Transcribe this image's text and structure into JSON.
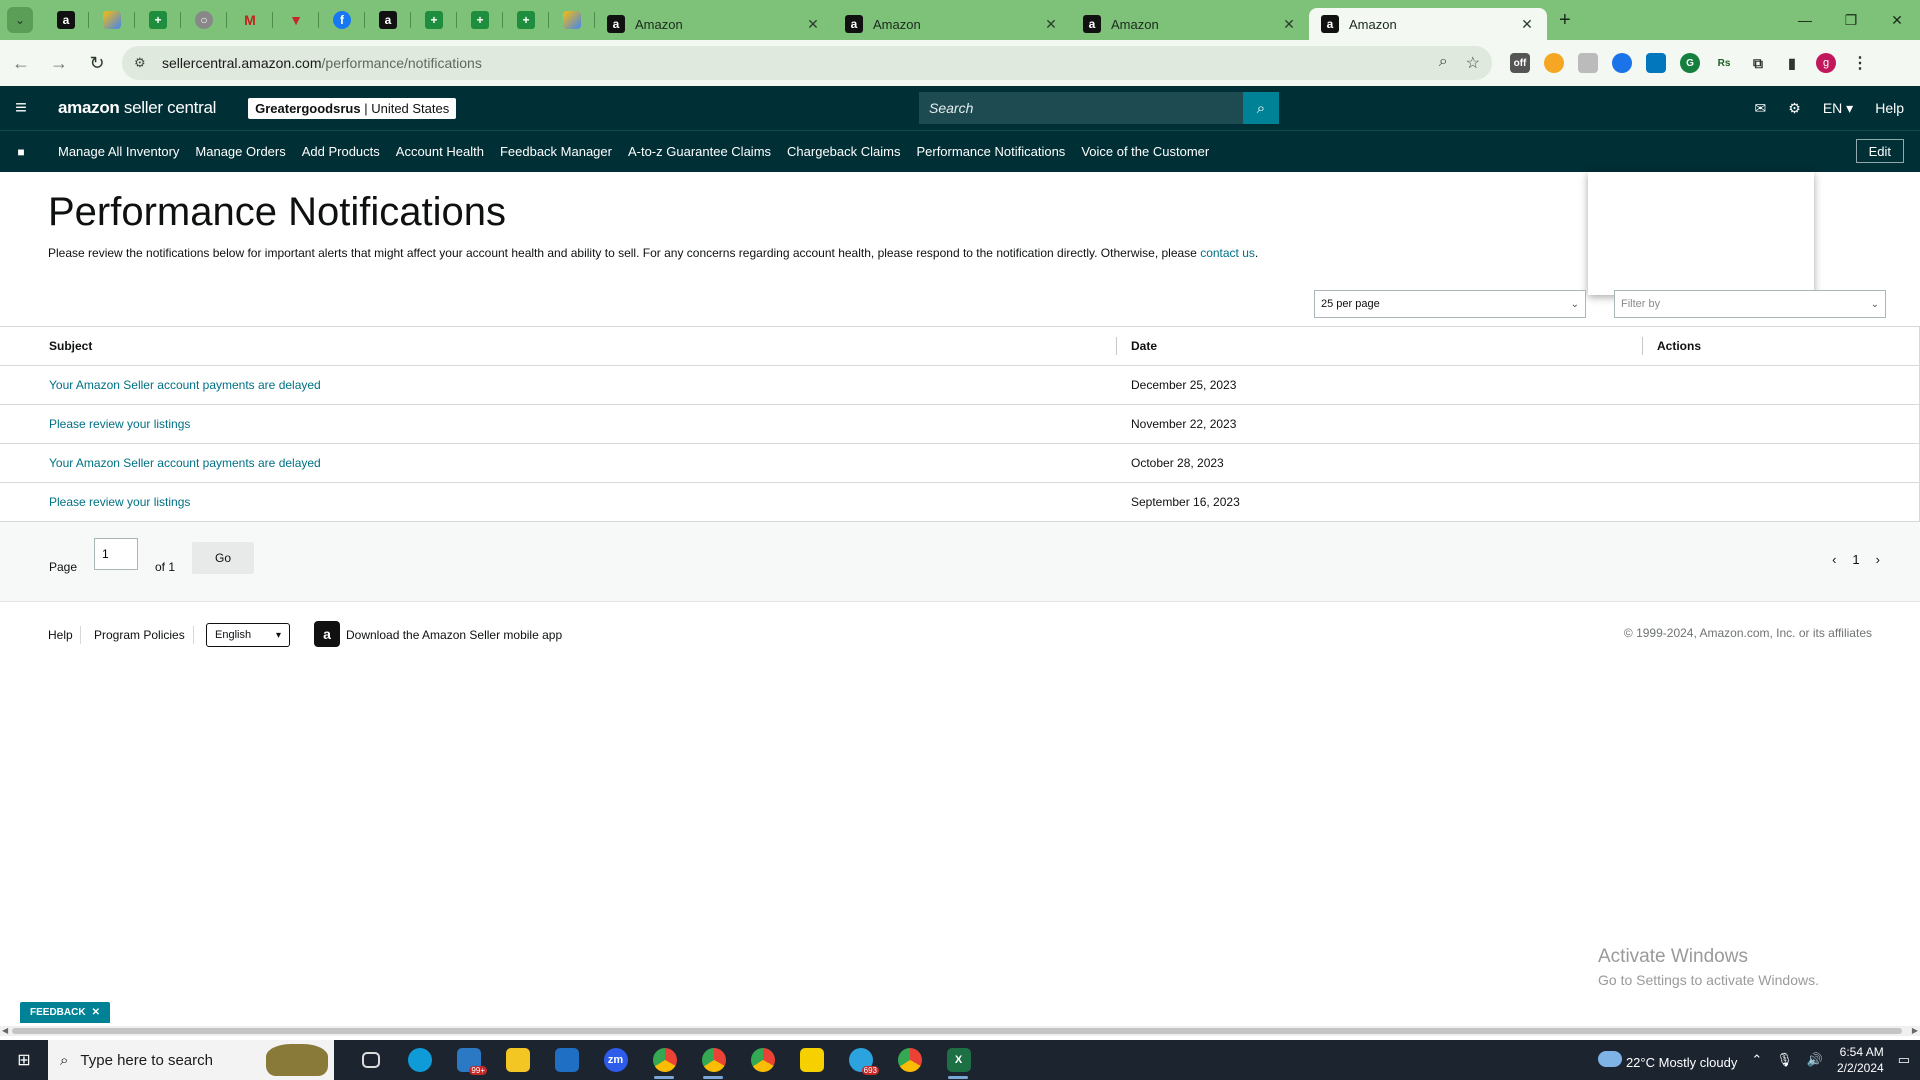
{
  "browser": {
    "tabs": [
      {
        "title": "Amazon",
        "active": false
      },
      {
        "title": "Amazon",
        "active": false
      },
      {
        "title": "Amazon",
        "active": false
      },
      {
        "title": "Amazon",
        "active": true
      }
    ],
    "url_domain": "sellercentral.amazon.com",
    "url_path": "/performance/notifications",
    "avatar_letter": "g"
  },
  "header": {
    "logo_bold": "amazon",
    "logo_rest": " seller central",
    "account_name": "Greatergoodsrus",
    "account_region": " | United States",
    "search_placeholder": "Search",
    "language": "EN",
    "help": "Help"
  },
  "nav": {
    "items": [
      "Manage All Inventory",
      "Manage Orders",
      "Add Products",
      "Account Health",
      "Feedback Manager",
      "A-to-z Guarantee Claims",
      "Chargeback Claims",
      "Performance Notifications",
      "Voice of the Customer"
    ],
    "edit": "Edit"
  },
  "page": {
    "title": "Performance Notifications",
    "intro": "Please review the notifications below for important alerts that might affect your account health and ability to sell. For any concerns regarding account health, please respond to the notification directly. Otherwise, please ",
    "intro_link": "contact us",
    "intro_end": ".",
    "per_page": "25 per page",
    "filter_placeholder": "Filter by"
  },
  "table": {
    "headers": {
      "subject": "Subject",
      "date": "Date",
      "actions": "Actions"
    },
    "rows": [
      {
        "subject": "Your Amazon Seller account payments are delayed",
        "date": "December 25, 2023"
      },
      {
        "subject": "Please review your listings",
        "date": "November 22, 2023"
      },
      {
        "subject": "Your Amazon Seller account payments are delayed",
        "date": "October 28, 2023"
      },
      {
        "subject": "Please review your listings",
        "date": "September 16, 2023"
      }
    ]
  },
  "pager": {
    "page_label": "Page",
    "page_value": "1",
    "of_label": "of 1",
    "go": "Go",
    "current": "1"
  },
  "footer": {
    "help": "Help",
    "policies": "Program Policies",
    "language": "English",
    "app_text": "Download the Amazon Seller mobile app",
    "copyright": "© 1999-2024, Amazon.com, Inc. or its affiliates"
  },
  "watermark": {
    "line1": "Activate Windows",
    "line2": "Go to Settings to activate Windows."
  },
  "feedback": "FEEDBACK",
  "taskbar": {
    "search_placeholder": "Type here to search",
    "mail_badge": "99+",
    "telegram_badge": "693",
    "weather": "22°C  Mostly cloudy",
    "time": "6:54 AM",
    "date": "2/2/2024"
  }
}
